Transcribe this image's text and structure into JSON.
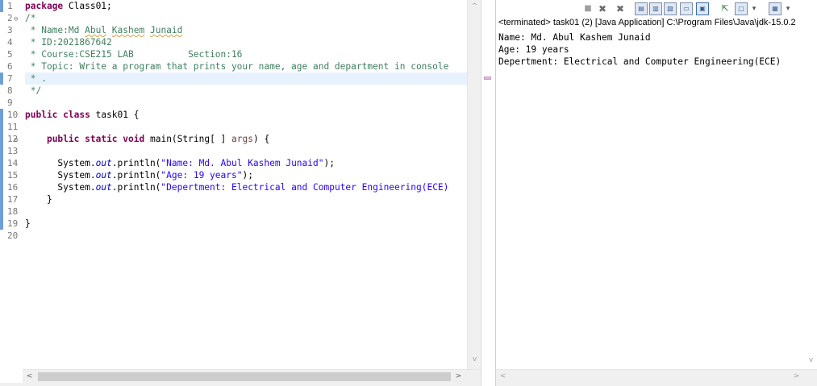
{
  "editor": {
    "line_numbers": [
      "1",
      "2",
      "3",
      "4",
      "5",
      "6",
      "7",
      "8",
      "9",
      "10",
      "11",
      "12",
      "13",
      "14",
      "15",
      "16",
      "17",
      "18",
      "19",
      "20"
    ],
    "code": {
      "l1_kw": "package",
      "l1_rest": " Class01;",
      "l2": "/*",
      "l3_a": " * Name:Md ",
      "l3_b": "Abul",
      "l3_c": " ",
      "l3_d": "Kashem",
      "l3_e": " ",
      "l3_f": "Junaid",
      "l4": " * ID:2021867642",
      "l5": " * Course:CSE215 LAB          Section:16",
      "l6": " * Topic: Write a program that prints your name, age and department in console",
      "l7": " * .",
      "l8": " */",
      "l10_kw1": "public",
      "l10_kw2": "class",
      "l10_rest": " task01 {",
      "l12_kw1": "public",
      "l12_kw2": "static",
      "l12_kw3": "void",
      "l12_rest": " main(String[ ] ",
      "l12_param": "args",
      "l12_end": ") {",
      "sys": "System.",
      "out": "out",
      "println": ".println(",
      "l14_str": "\"Name: Md. Abul Kashem Junaid\"",
      "l15_str": "\"Age: 19 years\"",
      "l16_str": "\"Depertment: Electrical and Computer Engineering(ECE)",
      "end_semi": ");",
      "l17": "    }",
      "l19": "}"
    },
    "scroll_left_arrow": "<",
    "scroll_right_arrow": ">",
    "scroll_up_arrow": "^",
    "scroll_down_arrow": "v"
  },
  "console": {
    "header": "<terminated> task01 (2) [Java Application] C:\\Program Files\\Java\\jdk-15.0.2",
    "output": [
      "Name: Md. Abul Kashem Junaid",
      "Age: 19 years",
      "Depertment: Electrical and Computer Engineering(ECE)"
    ],
    "scroll_left_arrow": "<",
    "scroll_right_arrow": ">",
    "scroll_up_arrow": "^",
    "scroll_down_arrow": "v",
    "toolbar_icons": [
      "terminate-icon",
      "remove-launch-icon",
      "remove-all-icon",
      "clear-console-icon",
      "scroll-lock-icon",
      "word-wrap-icon",
      "show-on-stdout-icon",
      "show-on-stderr-icon",
      "pin-console-icon",
      "display-console-icon",
      "open-console-icon"
    ],
    "toolbar_glyphs": {
      "terminate": "■",
      "remove": "✖",
      "remove_all": "✖",
      "dropdown": "▾"
    }
  }
}
